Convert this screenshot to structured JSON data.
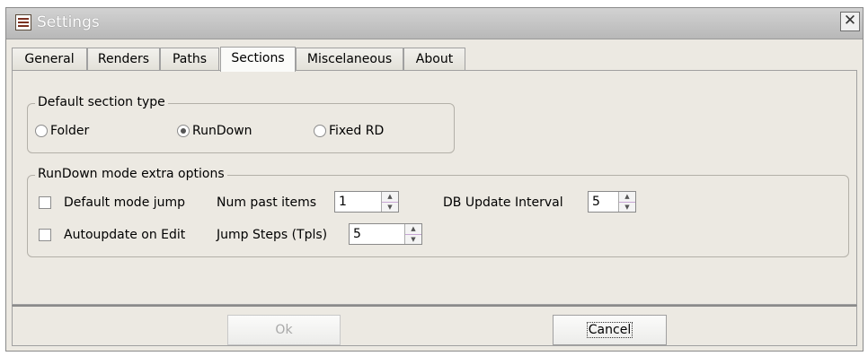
{
  "window": {
    "title": "Settings",
    "close_label": "✕"
  },
  "tabs": [
    {
      "label": "General",
      "active": false
    },
    {
      "label": "Renders",
      "active": false
    },
    {
      "label": "Paths",
      "active": false
    },
    {
      "label": "Sections",
      "active": true
    },
    {
      "label": "Miscelaneous",
      "active": false
    },
    {
      "label": "About",
      "active": false
    }
  ],
  "default_section_type": {
    "legend": "Default section type",
    "options": [
      {
        "label": "Folder",
        "selected": false
      },
      {
        "label": "RunDown",
        "selected": true
      },
      {
        "label": "Fixed RD",
        "selected": false
      }
    ]
  },
  "rundown_options": {
    "legend": "RunDown mode extra options",
    "default_mode_jump": {
      "label": "Default mode jump",
      "checked": false
    },
    "autoupdate_on_edit": {
      "label": "Autoupdate on Edit",
      "checked": false
    },
    "num_past_items": {
      "label": "Num past items",
      "value": "1"
    },
    "jump_steps": {
      "label": "Jump Steps (Tpls)",
      "value": "5"
    },
    "db_update_interval": {
      "label": "DB Update Interval",
      "value": "5"
    }
  },
  "buttons": {
    "ok": "Ok",
    "cancel": "Cancel"
  }
}
